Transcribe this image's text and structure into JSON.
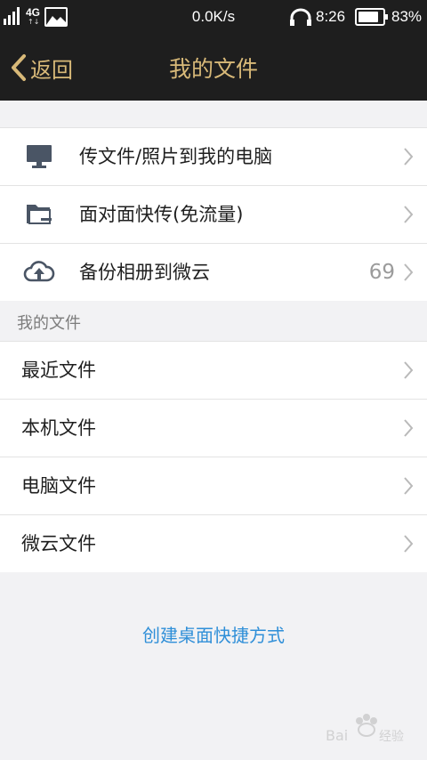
{
  "status_bar": {
    "network": "4G",
    "net_arrows": "↑↓",
    "speed": "0.0K/s",
    "time": "8:26",
    "battery_percent": "83%",
    "battery_level": 0.83,
    "signal_bars": 4
  },
  "header": {
    "back_label": "返回",
    "title": "我的文件"
  },
  "quick_actions": [
    {
      "label": "传文件/照片到我的电脑",
      "icon": "monitor-icon"
    },
    {
      "label": "面对面快传(免流量)",
      "icon": "folder-transfer-icon"
    },
    {
      "label": "备份相册到微云",
      "icon": "cloud-upload-icon",
      "count": "69"
    }
  ],
  "my_files": {
    "section_title": "我的文件",
    "items": [
      {
        "label": "最近文件"
      },
      {
        "label": "本机文件"
      },
      {
        "label": "电脑文件"
      },
      {
        "label": "微云文件"
      }
    ]
  },
  "footer": {
    "shortcut_label": "创建桌面快捷方式"
  },
  "colors": {
    "accent_gold": "#d8b978",
    "link_blue": "#2f8fd8",
    "bar_bg": "#1e1e1e",
    "page_bg": "#f2f2f4",
    "icon_slate": "#4a5565"
  }
}
